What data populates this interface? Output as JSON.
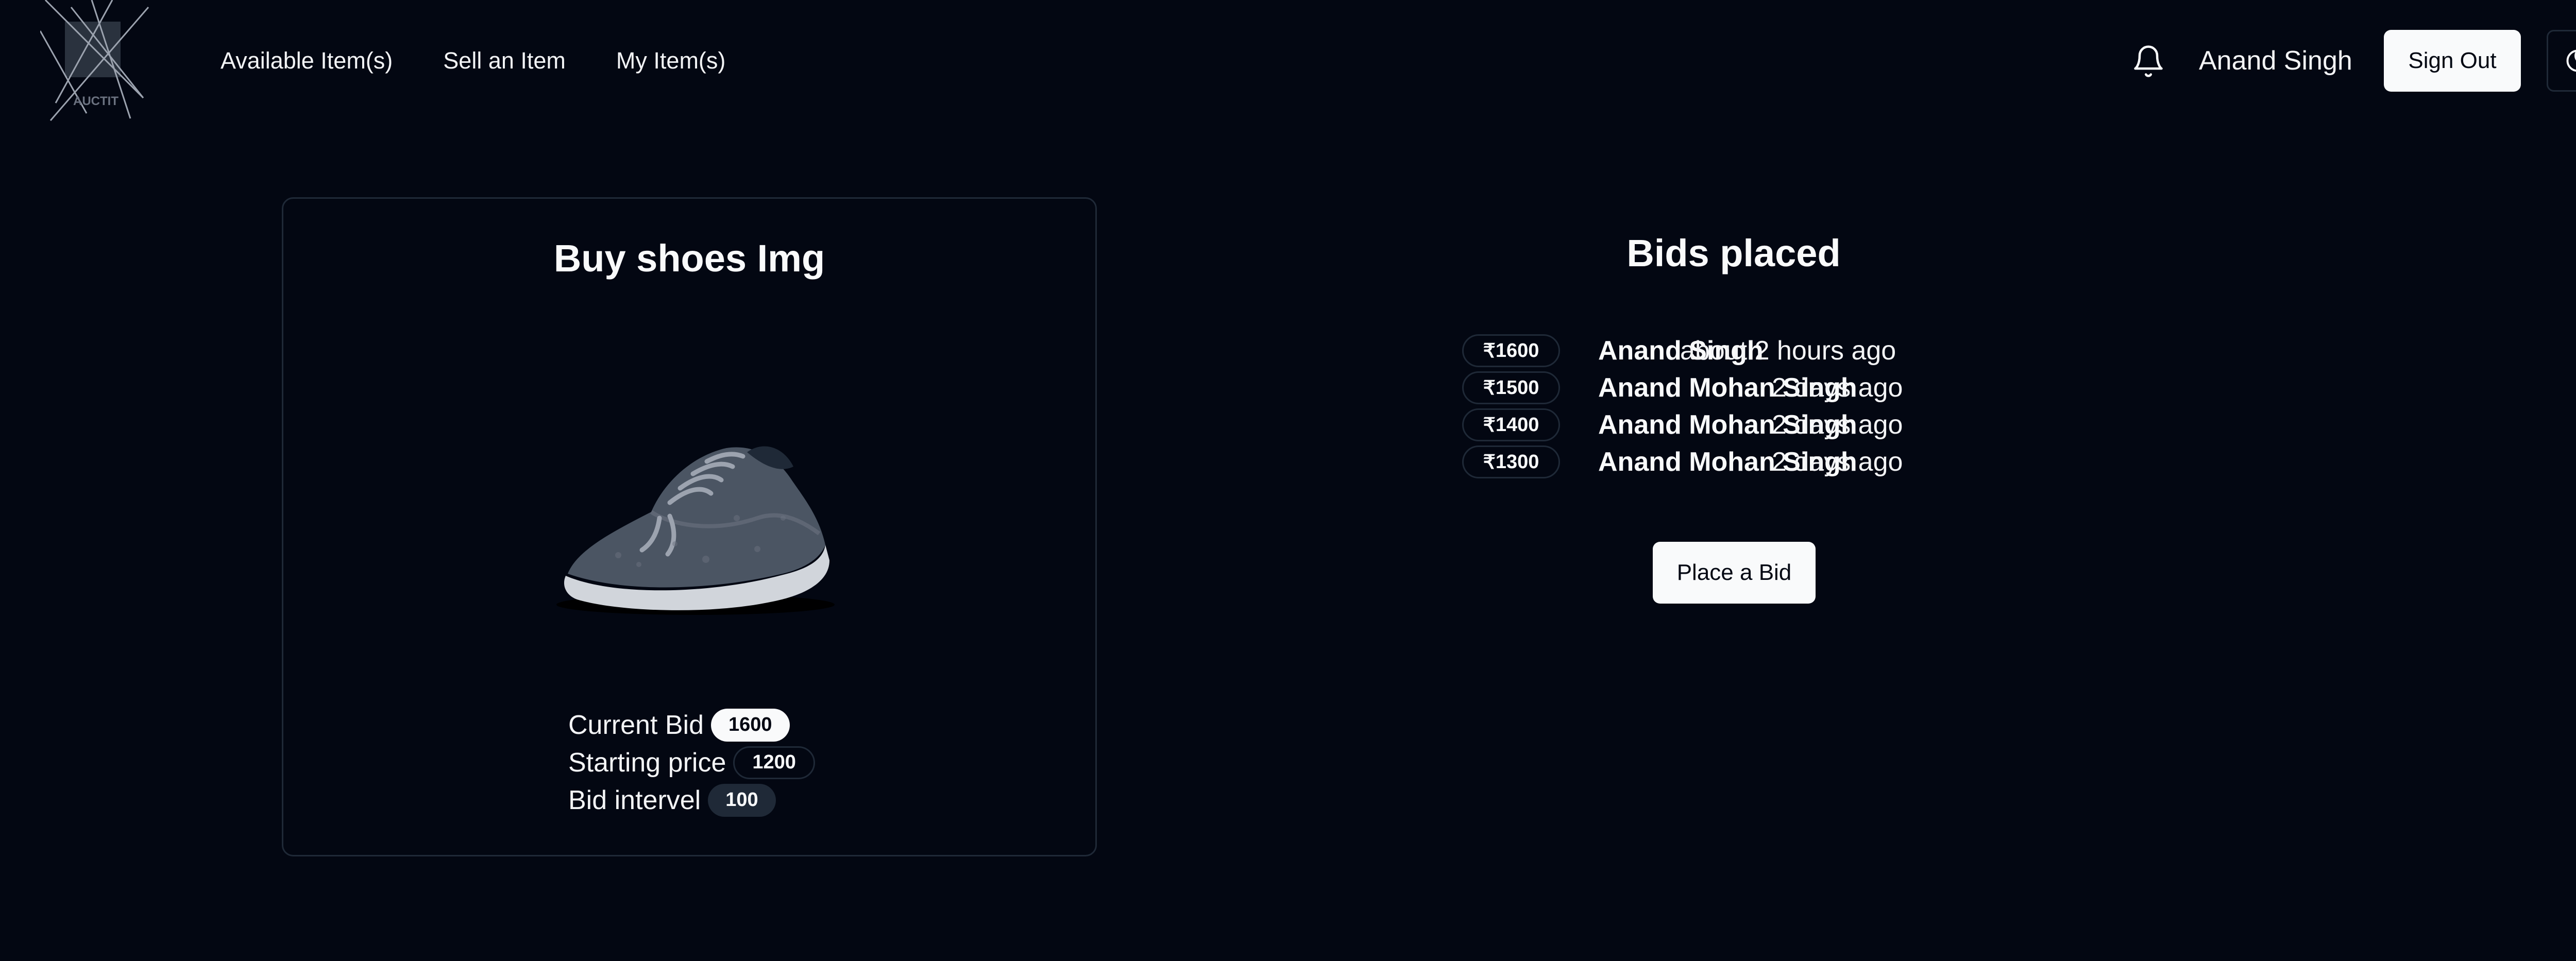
{
  "header": {
    "logo_text": "AUCTIT",
    "nav": [
      "Available Item(s)",
      "Sell an Item",
      "My Item(s)"
    ],
    "notification_icon": "bell-icon",
    "user_name": "Anand Singh",
    "sign_out_label": "Sign Out",
    "theme_icon": "moon-icon"
  },
  "item": {
    "title": "Buy shoes Img",
    "image": "shoe-image",
    "details": [
      {
        "label": "Current Bid",
        "value": "1600"
      },
      {
        "label": "Starting price",
        "value": "1200"
      },
      {
        "label": "Bid intervel",
        "value": "100"
      }
    ]
  },
  "bids": {
    "title": "Bids placed",
    "currency_symbol": "₹",
    "entries": [
      {
        "amount": "1600",
        "name": "Anand Singh",
        "time": "about 2 hours ago"
      },
      {
        "amount": "1500",
        "name": "Anand Mohan Singh",
        "time": "2 days ago"
      },
      {
        "amount": "1400",
        "name": "Anand Mohan Singh",
        "time": "2 days ago"
      },
      {
        "amount": "1300",
        "name": "Anand Mohan Singh",
        "time": "2 days ago"
      }
    ],
    "place_bid_label": "Place a Bid"
  },
  "colors": {
    "background": "#030712",
    "border": "#1f2937",
    "text": "#f9fafb"
  }
}
